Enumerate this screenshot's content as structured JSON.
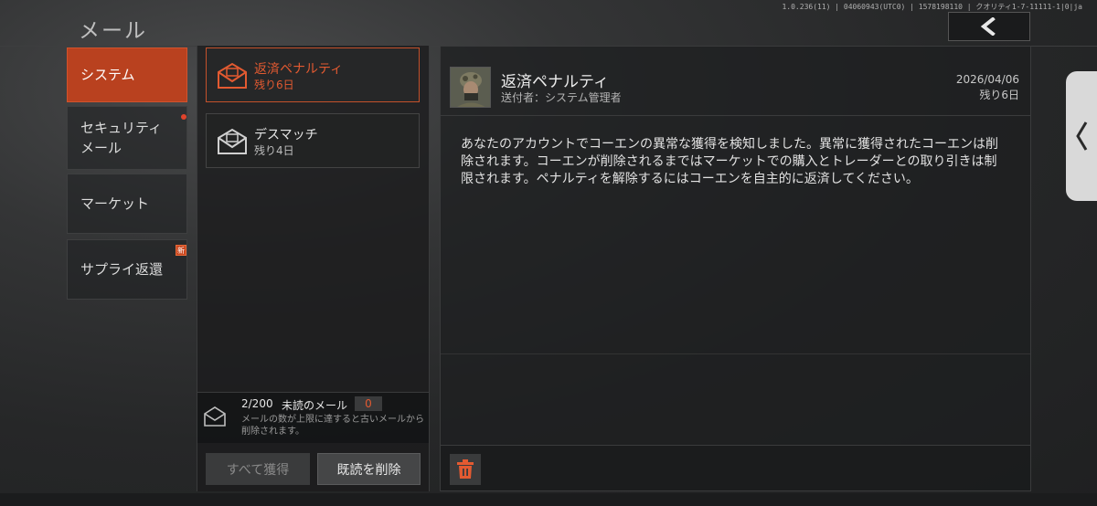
{
  "header": {
    "title": "メール",
    "build_info": "1.0.236(11) | 04060943(UTC0) | 1578198110 | クオリティ1-7-11111-1|0|ja"
  },
  "categories": [
    {
      "label": "システム",
      "active": true
    },
    {
      "label": "セキュリティメール",
      "active": false
    },
    {
      "label": "マーケット",
      "active": false
    },
    {
      "label": "サプライ返還",
      "active": false
    }
  ],
  "category_new_badge": "新",
  "mail_list": [
    {
      "title": "返済ペナルティ",
      "remaining": "残り6日",
      "selected": true
    },
    {
      "title": "デスマッチ",
      "remaining": "残り4日",
      "selected": false
    }
  ],
  "capacity": {
    "count": "2/200",
    "unread_label": "未読のメール",
    "unread_count": "0",
    "note": "メールの数が上限に達すると古いメールから削除されます。"
  },
  "buttons": {
    "claim_all": "すべて獲得",
    "delete_read": "既読を削除"
  },
  "detail": {
    "title": "返済ペナルティ",
    "sender": "送付者：システム管理者",
    "date": "2026/04/06",
    "remaining": "残り6日",
    "body": "あなたのアカウントでコーエンの異常な獲得を検知しました。異常に獲得されたコーエンは削除されます。コーエンが削除されるまではマーケットでの購入とトレーダーとの取り引きは制限されます。ペナルティを解除するにはコーエンを自主的に返済してください。"
  },
  "colors": {
    "accent": "#e35a31",
    "active_tab": "#b9411f",
    "notification_dot": "#e0432b"
  },
  "icons": [
    "back-arrow-icon",
    "envelope-icon",
    "trash-icon",
    "chevron-left-icon"
  ]
}
